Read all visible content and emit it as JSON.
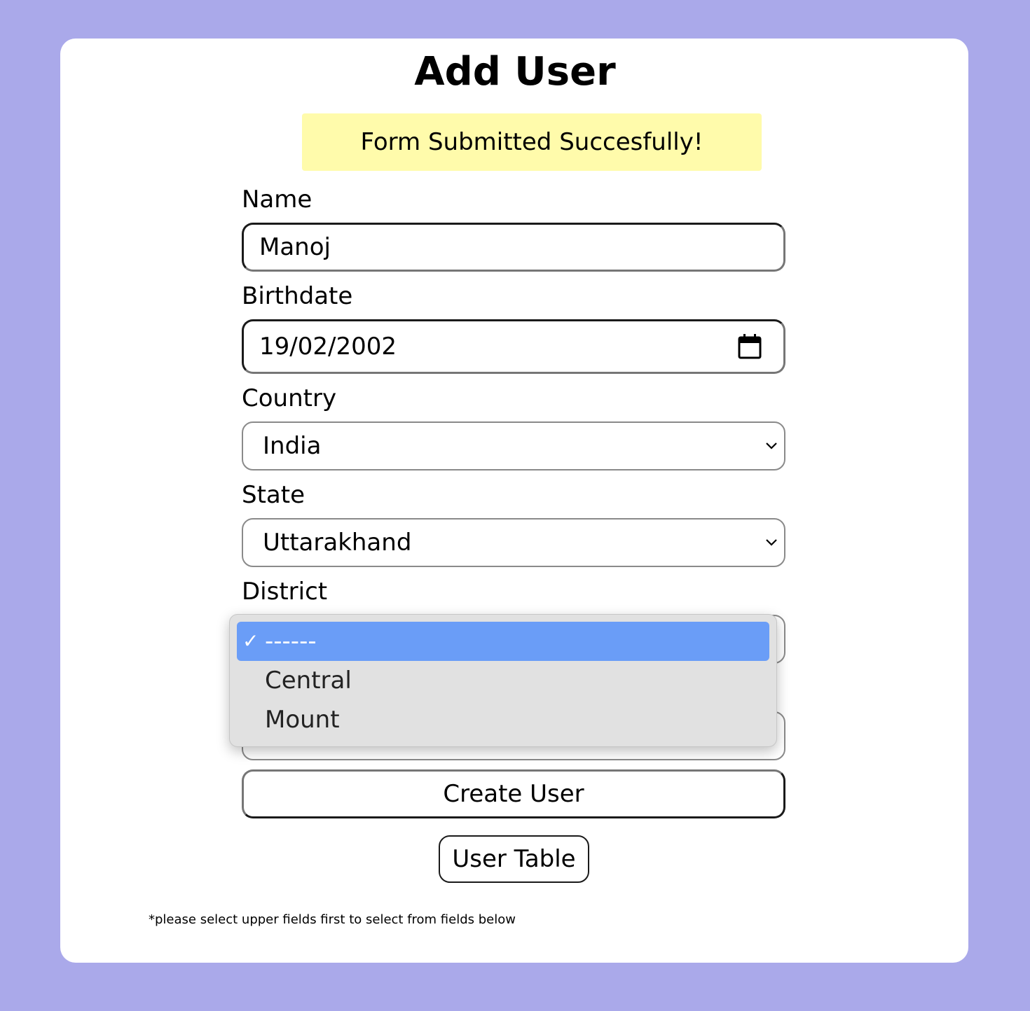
{
  "page": {
    "title": "Add User",
    "banner": "Form Submitted Succesfully!",
    "footnote": "*please select upper fields first to select from fields below"
  },
  "form": {
    "name": {
      "label": "Name",
      "value": "Manoj"
    },
    "birthdate": {
      "label": "Birthdate",
      "value": "19/02/2002"
    },
    "country": {
      "label": "Country",
      "value": "India"
    },
    "state": {
      "label": "State",
      "value": "Uttarakhand"
    },
    "district": {
      "label": "District",
      "open": true,
      "options": [
        {
          "label": "------",
          "selected": true
        },
        {
          "label": "Central",
          "selected": false
        },
        {
          "label": "Mount",
          "selected": false
        }
      ]
    }
  },
  "buttons": {
    "create": "Create User",
    "table": "User Table"
  },
  "colors": {
    "background": "#aaa9ea",
    "card": "#ffffff",
    "banner": "#fffbab",
    "selected_option": "#6a9df7",
    "dropdown_bg": "#e1e1e1"
  }
}
